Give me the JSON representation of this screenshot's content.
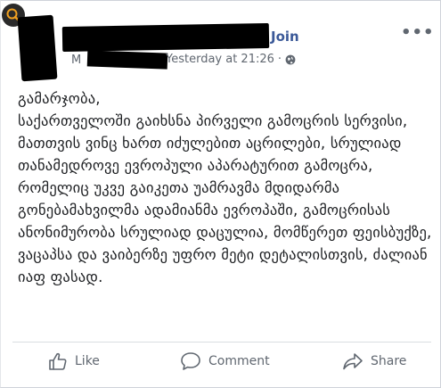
{
  "header": {
    "join_label": "Join",
    "subtitle_letter": "M",
    "timestamp": "Yesterday at 21:26",
    "separator": "·",
    "privacy_icon": "globe-icon",
    "more_label": "•••"
  },
  "post": {
    "text": "გამარჯობა,\nსაქართველოში გაიხსნა პირველი გამოცრის სერვისი, მათთვის ვინც ხართ იძულებით აცრილები, სრულიად თანამედროვე ევროპული აპარატურით გამოცრა, რომელიც უკვე გაიკეთა უამრავმა მდიდარმა გონებამახვილმა ადამიანმა ევროპაში, გამოცრისას ანონიმურობა სრულიად დაცულია, მომწერეთ ფეისბუქზე, ვაცაპსა და ვაიბერზე უფრო მეტი დეტალისთვის, ძალიან იაფ ფასად."
  },
  "actions": {
    "like_label": "Like",
    "comment_label": "Comment",
    "share_label": "Share"
  },
  "colors": {
    "accent": "#3b5998",
    "muted": "#606770",
    "search_bg": "#2a2a2a",
    "search_ring": "#f0a020"
  }
}
